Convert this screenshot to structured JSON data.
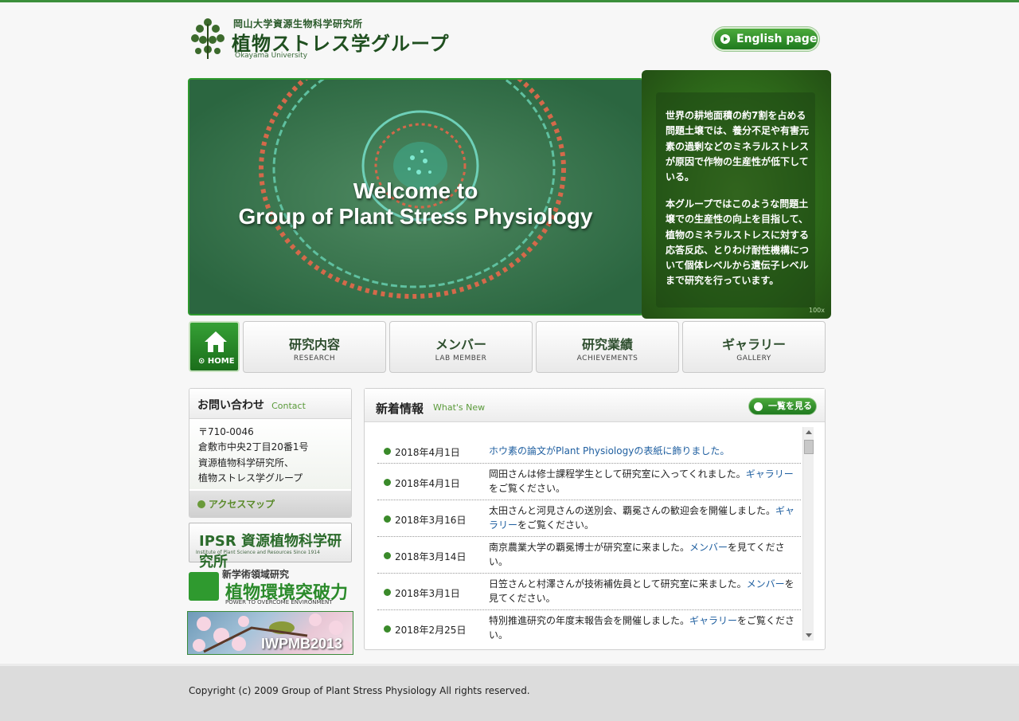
{
  "header": {
    "logo_sub": "岡山大学資源生物科学研究所",
    "logo_main": "植物ストレス学グループ",
    "logo_univ": "Okayama University",
    "english_button": "English page"
  },
  "hero": {
    "title_line1": "Welcome to",
    "title_line2": "Group of Plant Stress Physiology",
    "side_text_1": "世界の耕地面積の約7割を占める問題土壌では、養分不足や有害元素の過剰などのミネラルストレスが原因で作物の生産性が低下している。",
    "side_text_2": "本グループではこのような問題土壌での生産性の向上を目指して、植物のミネラルストレスに対する応答反応、とりわけ耐性機構について個体レベルから遺伝子レベルまで研究を行っています。",
    "badge": "100x"
  },
  "nav": {
    "home": "HOME",
    "items": [
      {
        "jp": "研究内容",
        "en": "RESEARCH"
      },
      {
        "jp": "メンバー",
        "en": "LAB MEMBER"
      },
      {
        "jp": "研究業績",
        "en": "ACHIEVEMENTS"
      },
      {
        "jp": "ギャラリー",
        "en": "GALLERY"
      }
    ]
  },
  "contact": {
    "title_jp": "お問い合わせ",
    "title_en": "Contact",
    "lines": [
      "〒710-0046",
      "倉敷市中央2丁目20番1号",
      "資源植物科学研究所、",
      "植物ストレス学グループ"
    ],
    "map_link": "アクセスマップ"
  },
  "banners": {
    "ipsr_big": "IPSR 資源植物科学研究所",
    "ipsr_small": "Institute of Plant Science and Resources  Since 1914",
    "kankyo_top": "新学術領域研究",
    "kankyo_main": "植物環境突破力",
    "kankyo_bottom": "POWER TO OVERCOME ENVIRONMENT",
    "iwpmb": "IWPMB2013"
  },
  "news": {
    "title_jp": "新着情報",
    "title_en": "What's New",
    "more_button": "一覧を見る",
    "items": [
      {
        "date": "2018年4月1日",
        "pre": "",
        "link": "ホウ素の論文がPlant  Physiologyの表紙に飾りました。",
        "post": ""
      },
      {
        "date": "2018年4月1日",
        "pre": "岡田さんは修士課程学生として研究室に入ってくれました。",
        "link": "ギャラリー",
        "post": "をご覧ください。"
      },
      {
        "date": "2018年3月16日",
        "pre": "太田さんと河見さんの送別会、覇冕さんの歓迎会を開催しました。",
        "link": "ギャラリー",
        "post": "をご覧ください。"
      },
      {
        "date": "2018年3月14日",
        "pre": "南京農業大学の覇冕博士が研究室に来ました。",
        "link": "メンバー",
        "post": "を見てください。"
      },
      {
        "date": "2018年3月1日",
        "pre": "日笠さんと村澤さんが技術補佐員として研究室に来ました。",
        "link": "メンバー",
        "post": "を見てください。"
      },
      {
        "date": "2018年2月25日",
        "pre": "特別推進研究の年度末報告会を開催しました。",
        "link": "ギャラリー",
        "post": "をご覧ください。"
      }
    ]
  },
  "footer": {
    "copyright": "Copyright (c) 2009 Group of Plant Stress Physiology All rights reserved."
  }
}
